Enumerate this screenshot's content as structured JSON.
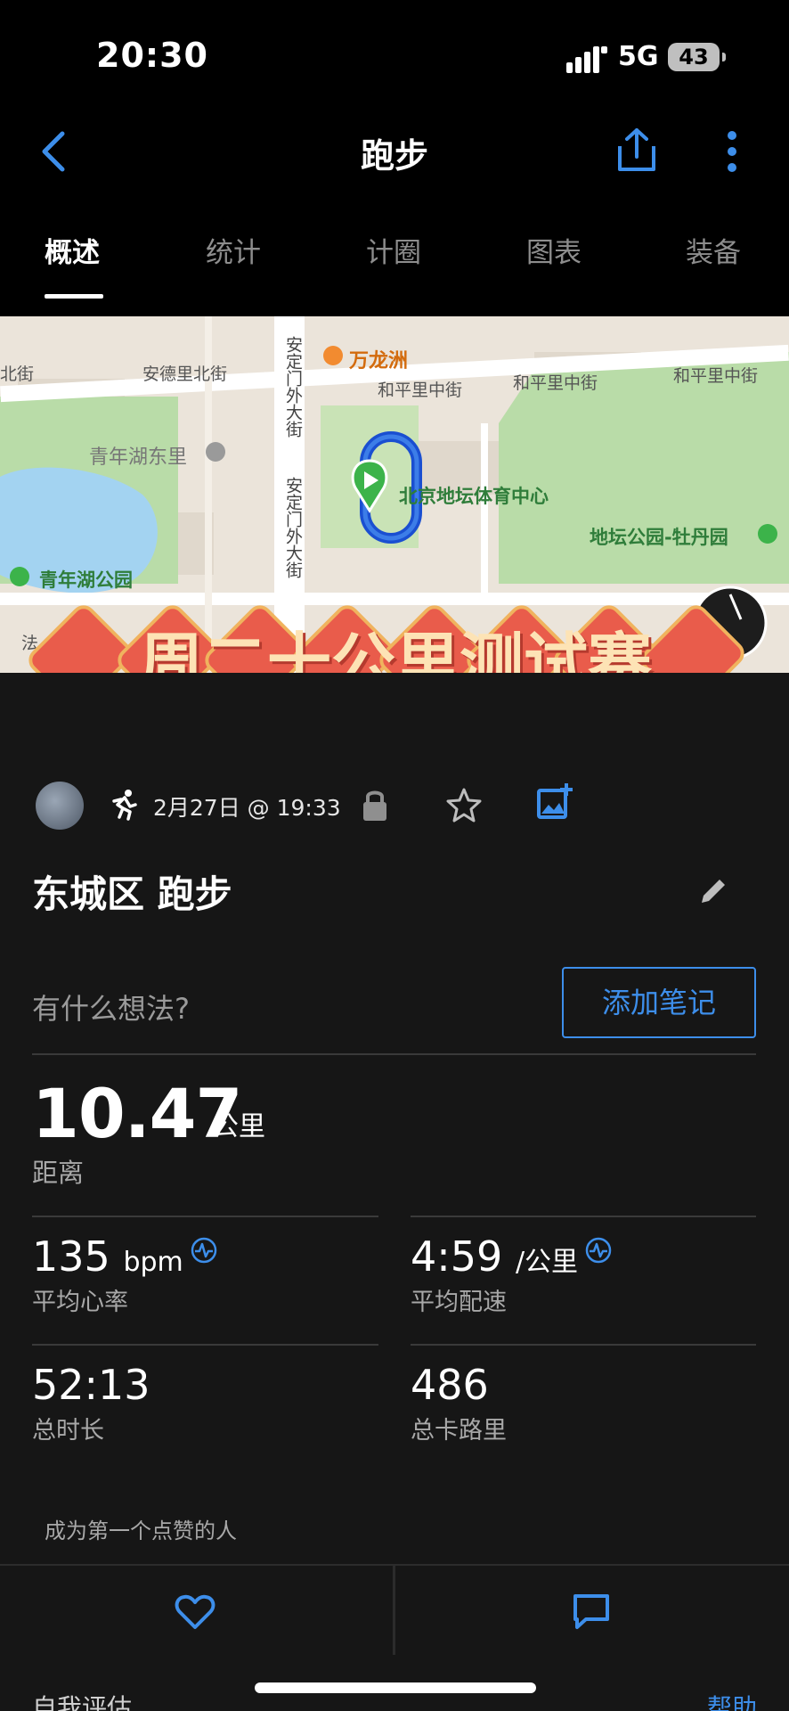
{
  "status_bar": {
    "time": "20:30",
    "network": "5G",
    "battery": "43"
  },
  "header": {
    "title": "跑步"
  },
  "tabs": [
    {
      "label": "概述"
    },
    {
      "label": "统计"
    },
    {
      "label": "计圈"
    },
    {
      "label": "图表"
    },
    {
      "label": "装备"
    }
  ],
  "map": {
    "labels": [
      "安德里北街",
      "北街",
      "和平里中街",
      "和平里中街",
      "和平里中街",
      "青年湖东里",
      "北京地坛体育中心",
      "地坛公园-牡丹园",
      "青年湖公园",
      "万龙洲",
      "安定门外大街",
      "安定门外大街",
      "法"
    ],
    "overlay_banner": "周二十公里测试赛",
    "colors": {
      "route": "#1a4fd1",
      "park": "#b9dca8",
      "water": "#a3d3f1"
    }
  },
  "activity": {
    "date": "2月27日 @ 19:33",
    "title": "东城区 跑步",
    "thoughts_placeholder": "有什么想法?",
    "add_note_label": "添加笔记"
  },
  "stats": {
    "distance": {
      "value": "10.47",
      "unit": "公里",
      "label": "距离"
    },
    "heart_rate": {
      "value": "135",
      "unit": "bpm",
      "label": "平均心率"
    },
    "pace": {
      "value": "4:59",
      "unit": "/公里",
      "label": "平均配速"
    },
    "duration": {
      "value": "52:13",
      "label": "总时长"
    },
    "calories": {
      "value": "486",
      "label": "总卡路里"
    }
  },
  "social": {
    "likes_text": "成为第一个点赞的人"
  },
  "bottom": {
    "self_eval": "自我评估",
    "help": "帮助"
  },
  "colors": {
    "accent": "#3d8eea",
    "background": "#161616",
    "banner_red": "#e95c4b",
    "banner_text": "#fde3b5"
  }
}
